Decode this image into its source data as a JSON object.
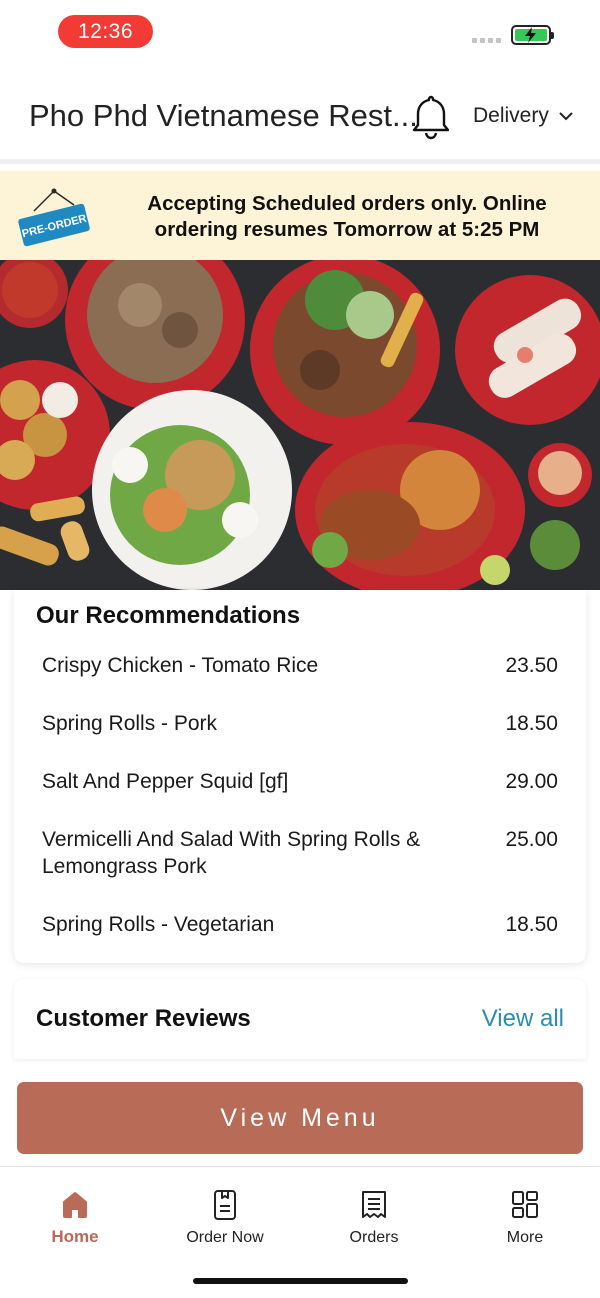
{
  "status_bar": {
    "time": "12:36",
    "battery_color": "#34c759"
  },
  "header": {
    "title": "Pho Phd Vietnamese Rest...",
    "notification_icon": "bell-icon",
    "delivery_label": "Delivery"
  },
  "banner": {
    "sign_label": "PRE-ORDER",
    "message": "Accepting Scheduled orders only. Online ordering resumes Tomorrow at 5:25 PM",
    "background": "#fdf3d6"
  },
  "recommendations": {
    "title": "Our Recommendations",
    "items": [
      {
        "name": "Crispy Chicken - Tomato Rice",
        "price": "23.50"
      },
      {
        "name": "Spring Rolls - Pork",
        "price": "18.50"
      },
      {
        "name": "Salt And Pepper Squid [gf]",
        "price": "29.00"
      },
      {
        "name": "Vermicelli And Salad With Spring Rolls & Lemongrass Pork",
        "price": "25.00"
      },
      {
        "name": "Spring Rolls - Vegetarian",
        "price": "18.50"
      }
    ]
  },
  "reviews": {
    "title": "Customer Reviews",
    "view_all_label": "View all",
    "link_color": "#2a8db4"
  },
  "view_menu_label": "View Menu",
  "brand_color": "#b86b56",
  "tabs": [
    {
      "label": "Home",
      "icon": "home-icon",
      "active": true
    },
    {
      "label": "Order Now",
      "icon": "order-device-icon",
      "active": false
    },
    {
      "label": "Orders",
      "icon": "receipt-icon",
      "active": false
    },
    {
      "label": "More",
      "icon": "grid-icon",
      "active": false
    }
  ]
}
